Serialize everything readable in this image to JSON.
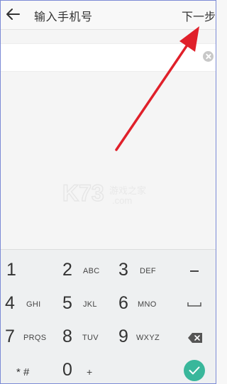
{
  "header": {
    "title": "输入手机号",
    "next_label": "下一步"
  },
  "phone_input": {
    "value": ""
  },
  "watermark": {
    "brand": "K73",
    "site": "游戏之家",
    "domain": ".com"
  },
  "keypad": {
    "rows": [
      [
        {
          "digit": "1",
          "letters": ""
        },
        {
          "digit": "2",
          "letters": "ABC"
        },
        {
          "digit": "3",
          "letters": "DEF"
        }
      ],
      [
        {
          "digit": "4",
          "letters": "GHI"
        },
        {
          "digit": "5",
          "letters": "JKL"
        },
        {
          "digit": "6",
          "letters": "MNO"
        }
      ],
      [
        {
          "digit": "7",
          "letters": "PRQS"
        },
        {
          "digit": "8",
          "letters": "TUV"
        },
        {
          "digit": "9",
          "letters": "WXYZ"
        }
      ],
      [
        {
          "digit": "* #",
          "letters": ""
        },
        {
          "digit": "0",
          "letters": "+"
        },
        {
          "digit": "",
          "letters": ""
        }
      ]
    ],
    "side_keys": [
      "minus-icon",
      "space-icon",
      "backspace-icon",
      "done-check-icon"
    ],
    "done_color": "#39b79b"
  },
  "annotation": {
    "arrow_color": "#e0202a"
  }
}
